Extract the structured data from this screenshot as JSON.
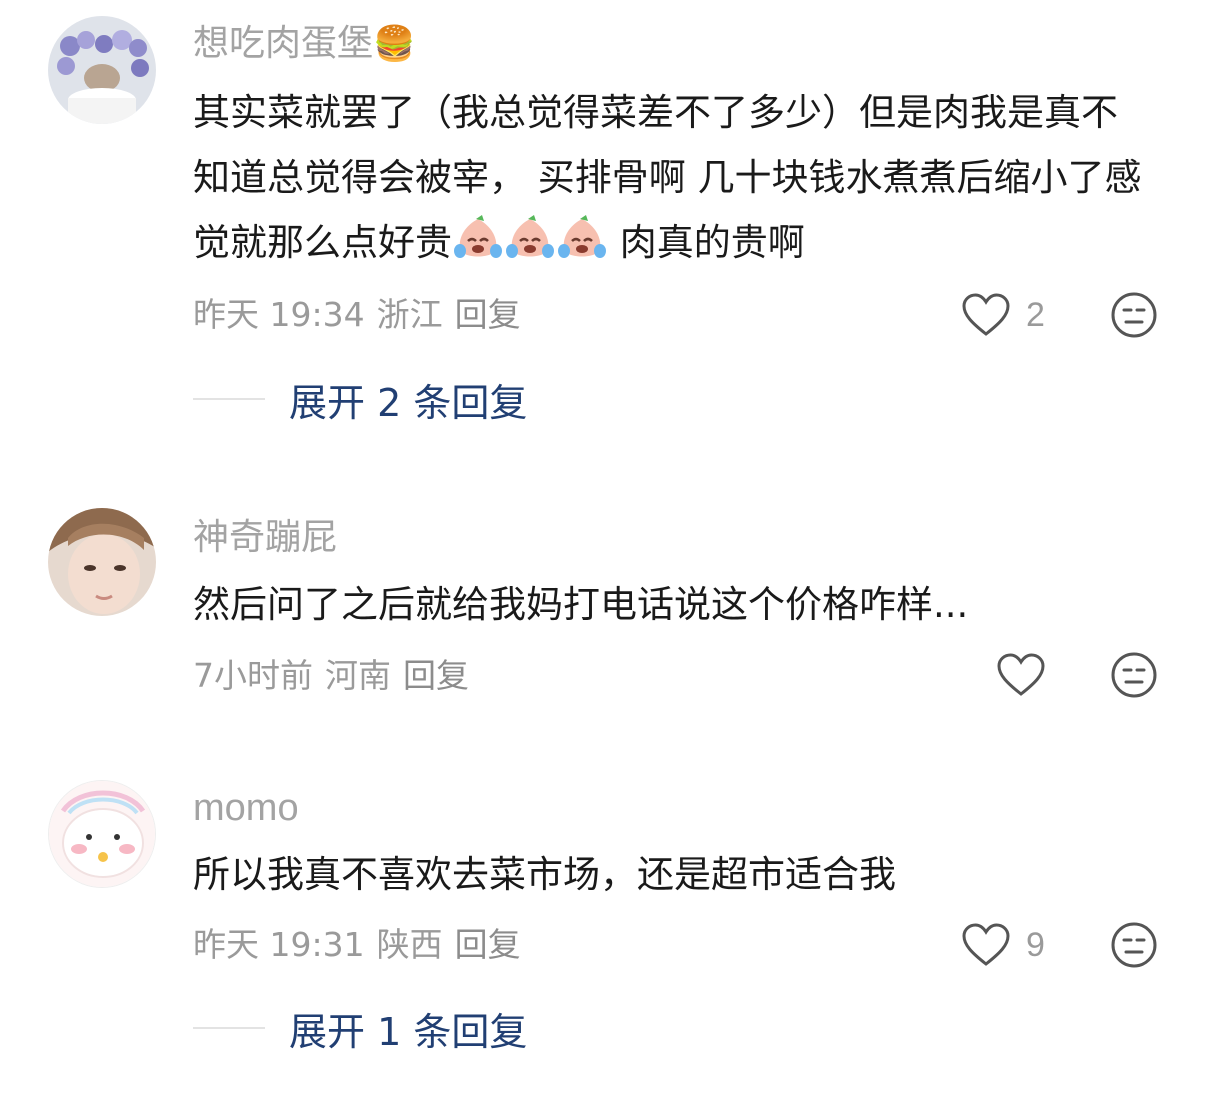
{
  "comments": [
    {
      "username": "想吃肉蛋堡",
      "username_emoji": "🍔",
      "text": "其实菜就罢了（我总觉得菜差不了多少）但是肉我是真不知道总觉得会被宰， 买排骨啊 几十块钱水煮煮后缩小了感觉就那么点好贵",
      "text_tail": " 肉真的贵啊",
      "time": "昨天 19:34",
      "location": "浙江",
      "reply_label": "回复",
      "likes": "2",
      "expand_label": "展开 2 条回复"
    },
    {
      "username": "神奇蹦屁",
      "text": "然后问了之后就给我妈打电话说这个价格咋样...",
      "time": "7小时前",
      "location": "河南",
      "reply_label": "回复",
      "likes": ""
    },
    {
      "username": "momo",
      "text": "所以我真不喜欢去菜市场，还是超市适合我",
      "time": "昨天 19:31",
      "location": "陕西",
      "reply_label": "回复",
      "likes": "9",
      "expand_label": "展开 1 条回复"
    }
  ],
  "colors": {
    "username": "#a3a3a3",
    "body_text": "#1a1a1a",
    "meta": "#9a9a9a",
    "expand_link": "#213f73"
  },
  "icons": {
    "like": "heart-outline-icon",
    "dislike": "meh-face-icon",
    "crying_emoji": "crying-laughing-peach-emoji"
  }
}
